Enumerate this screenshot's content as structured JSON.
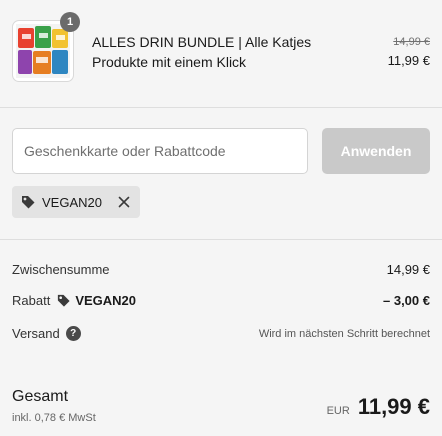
{
  "product": {
    "quantity": "1",
    "title": "ALLES DRIN BUNDLE | Alle Katjes Produkte mit einem Klick",
    "original_price": "14,99 €",
    "price": "11,99 €",
    "thumbnail_icon": "product-bundle-image"
  },
  "discount": {
    "placeholder": "Geschenkkarte oder Rabattcode",
    "value": "",
    "apply_label": "Anwenden",
    "applied_code": "VEGAN20",
    "tag_icon": "tag-icon",
    "remove_icon": "close-icon"
  },
  "summary": {
    "subtotal_label": "Zwischensumme",
    "subtotal_value": "14,99 €",
    "discount_label": "Rabatt",
    "discount_code": "VEGAN20",
    "discount_value": "– 3,00 €",
    "shipping_label": "Versand",
    "shipping_value": "Wird im nächsten Schritt berechnet",
    "help_icon": "question-icon"
  },
  "total": {
    "label": "Gesamt",
    "tax_note": "inkl. 0,78 € MwSt",
    "currency": "EUR",
    "amount": "11,99 €"
  },
  "colors": {
    "background": "#f5f5f5",
    "button_disabled": "#c9c9c9",
    "tag_background": "#e3e3e3",
    "badge": "#6b6b6b"
  }
}
